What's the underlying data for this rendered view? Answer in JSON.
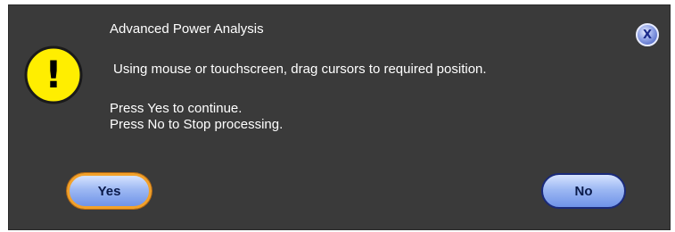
{
  "dialog": {
    "title": "Advanced Power Analysis",
    "message": "Using mouse or touchscreen, drag cursors to required position.",
    "instruction_line1": "Press Yes to continue.",
    "instruction_line2": "Press No to Stop processing.",
    "close_label": "X",
    "warning_icon": "exclamation-warning-icon",
    "warning_symbol": "!"
  },
  "buttons": {
    "yes_label": "Yes",
    "no_label": "No"
  },
  "colors": {
    "background": "#3a3a3a",
    "warning_fill": "#ffee00",
    "yes_border": "#f2a12a",
    "button_fill": "#9db8f3"
  }
}
